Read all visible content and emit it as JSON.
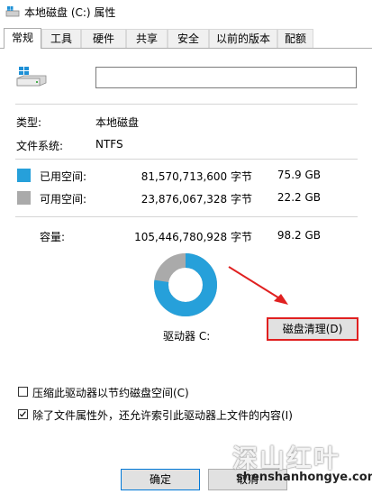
{
  "window": {
    "title": "本地磁盘 (C:) 属性",
    "icon": "drive-icon"
  },
  "tabs": [
    {
      "label": "常规",
      "active": true
    },
    {
      "label": "工具",
      "active": false
    },
    {
      "label": "硬件",
      "active": false
    },
    {
      "label": "共享",
      "active": false
    },
    {
      "label": "安全",
      "active": false
    },
    {
      "label": "以前的版本",
      "active": false
    },
    {
      "label": "配额",
      "active": false
    }
  ],
  "general": {
    "name_value": "",
    "type_label": "类型:",
    "type_value": "本地磁盘",
    "fs_label": "文件系统:",
    "fs_value": "NTFS",
    "used": {
      "label": "已用空间:",
      "bytes": "81,570,713,600 字节",
      "size": "75.9 GB",
      "color": "#26a0da"
    },
    "free": {
      "label": "可用空间:",
      "bytes": "23,876,067,328 字节",
      "size": "22.2 GB",
      "color": "#aaaaaa"
    },
    "capacity": {
      "label": "容量:",
      "bytes": "105,446,780,928 字节",
      "size": "98.2 GB"
    },
    "used_fraction": 0.7736,
    "drive_label": "驱动器 C:",
    "cleanup_button": "磁盘清理(D)",
    "compress_option": {
      "label": "压缩此驱动器以节约磁盘空间(C)",
      "checked": false
    },
    "index_option": {
      "label": "除了文件属性外，还允许索引此驱动器上文件的内容(I)",
      "checked": true
    },
    "highlight_color": "#e02020"
  },
  "buttons": {
    "ok": "确定",
    "cancel": "取消"
  },
  "watermark": {
    "text": "深山红叶",
    "url": "shenshanhongye.com"
  }
}
